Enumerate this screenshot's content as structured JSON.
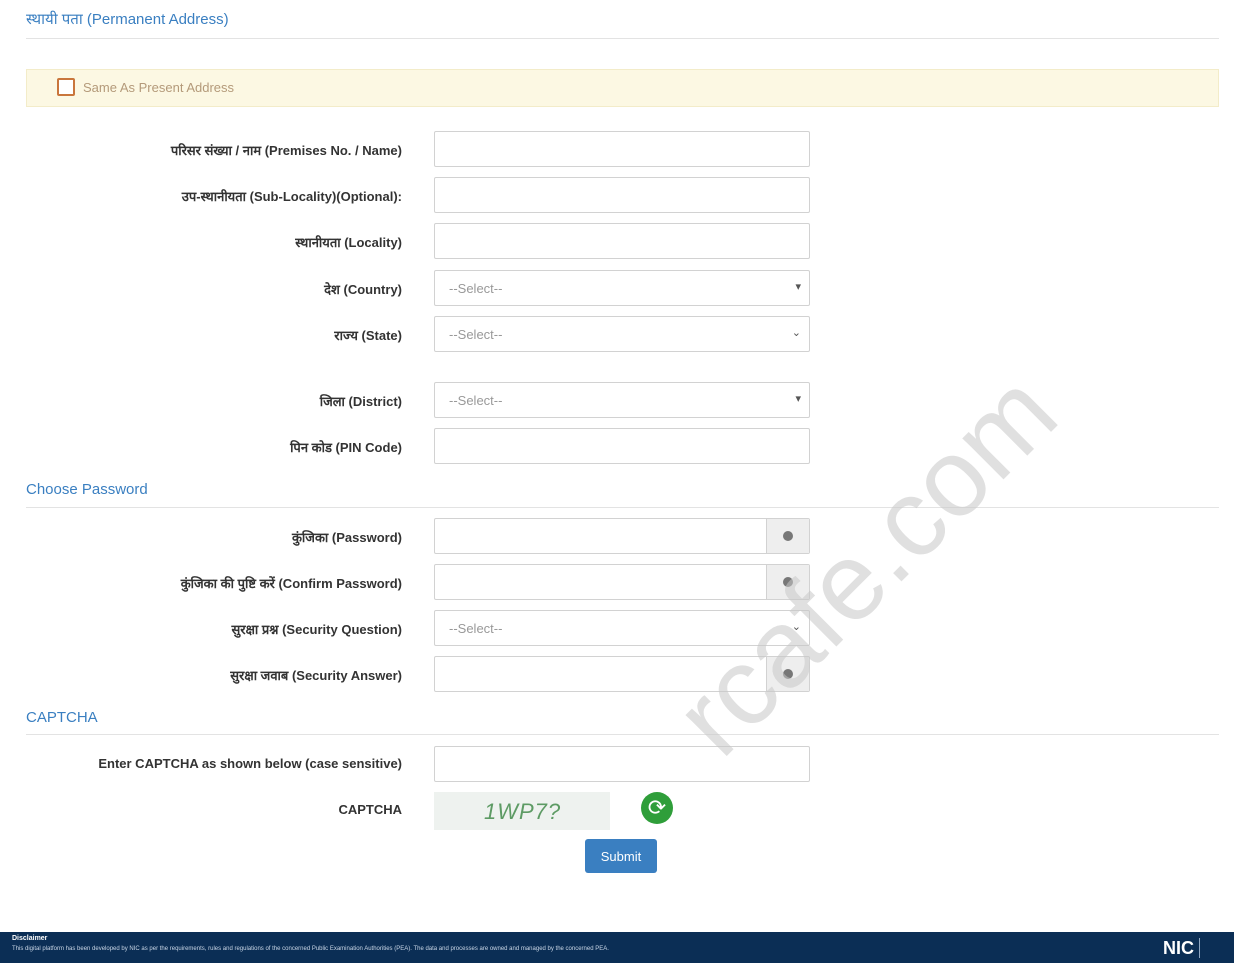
{
  "permanent": {
    "title": "स्थायी पता (Permanent Address)",
    "same_as_label": "Same As Present Address",
    "fields": [
      {
        "label": "परिसर संख्या / नाम (Premises No. / Name)",
        "value": ""
      },
      {
        "label": "उप-स्थानीयता (Sub-Locality)(Optional):",
        "value": ""
      },
      {
        "label": "स्थानीयता (Locality)",
        "value": ""
      },
      {
        "label": "देश (Country)",
        "value": "--Select--"
      },
      {
        "label": "राज्य (State)",
        "value": "--Select--"
      },
      {
        "label": "जिला (District)",
        "value": "--Select--"
      },
      {
        "label": "पिन कोड (PIN Code)",
        "value": ""
      }
    ]
  },
  "password": {
    "title": "Choose Password",
    "fields": [
      {
        "label": "कुंजिका (Password)",
        "value": ""
      },
      {
        "label": "कुंजिका की पुष्टि करें (Confirm Password)",
        "value": ""
      },
      {
        "label": "सुरक्षा प्रश्न (Security Question)",
        "value": "--Select--"
      },
      {
        "label": "सुरक्षा जवाब (Security Answer)",
        "value": ""
      }
    ]
  },
  "captcha": {
    "title": "CAPTCHA",
    "enter_label": "Enter CAPTCHA as shown below (case sensitive)",
    "captcha_label": "CAPTCHA",
    "code": "1WP7?",
    "submit_label": "Submit"
  },
  "footer": {
    "title": "Disclaimer",
    "text": "This digital platform has been developed by NIC as per the requirements, rules and regulations of the concerned Public Examination Authorities (PEA). The data and processes are owned and managed by the concerned PEA.",
    "logo": "NIC"
  },
  "watermark": "rcafe.com",
  "icons": {
    "eye": "eye-icon",
    "chevron": "chevron-down-icon",
    "refresh": "refresh-icon",
    "checkbox": "checkbox-icon"
  },
  "colors": {
    "accent": "#3a7fc1",
    "notice_bg": "#fcf8e3",
    "footer_bg": "#0b2e55",
    "refresh": "#2f9e3a"
  }
}
